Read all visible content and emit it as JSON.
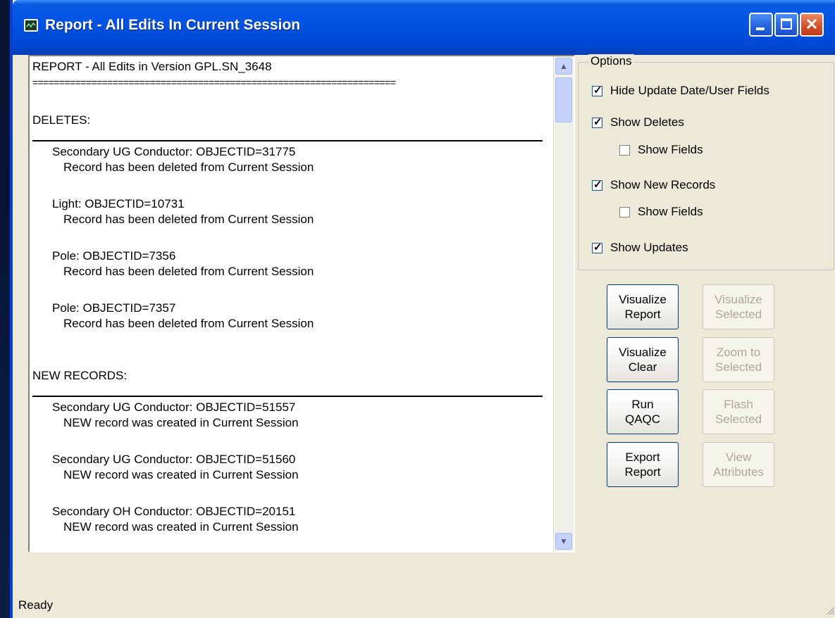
{
  "window": {
    "title": "Report - All Edits In Current Session",
    "controls": [
      "minimize",
      "maximize",
      "close"
    ]
  },
  "report": {
    "header": "REPORT - All Edits in Version GPL.SN_3648",
    "rule": "====================================================================",
    "sections": [
      {
        "heading": "DELETES:",
        "entries": [
          {
            "title": "Secondary UG Conductor: OBJECTID=31775",
            "detail": "Record has been deleted from Current Session"
          },
          {
            "title": "Light: OBJECTID=10731",
            "detail": "Record has been deleted from Current Session"
          },
          {
            "title": "Pole: OBJECTID=7356",
            "detail": "Record has been deleted from Current Session"
          },
          {
            "title": "Pole: OBJECTID=7357",
            "detail": "Record has been deleted from Current Session"
          }
        ]
      },
      {
        "heading": "NEW RECORDS:",
        "entries": [
          {
            "title": "Secondary UG Conductor: OBJECTID=51557",
            "detail": "NEW record was created in Current Session"
          },
          {
            "title": "Secondary UG Conductor: OBJECTID=51560",
            "detail": "NEW record was created in Current Session"
          },
          {
            "title": "Secondary OH Conductor: OBJECTID=20151",
            "detail": "NEW record was created in Current Session"
          }
        ]
      }
    ]
  },
  "options": {
    "legend": "Options",
    "checkboxes": [
      {
        "label": "Hide Update Date/User Fields",
        "checked": true
      },
      {
        "label": "Show Deletes",
        "checked": true
      },
      {
        "label": "Show Fields",
        "checked": false
      },
      {
        "label": "Show New Records",
        "checked": true
      },
      {
        "label": "Show Fields",
        "checked": false
      },
      {
        "label": "Show Updates",
        "checked": true
      }
    ]
  },
  "buttons": {
    "visualize_report": [
      "Visualize",
      "Report"
    ],
    "visualize_selected": [
      "Visualize",
      "Selected"
    ],
    "visualize_clear": [
      "Visualize",
      "Clear"
    ],
    "zoom_to_selected": [
      "Zoom to",
      "Selected"
    ],
    "run_qaqc": [
      "Run",
      "QAQC"
    ],
    "flash_selected": [
      "Flash",
      "Selected"
    ],
    "export_report": [
      "Export",
      "Report"
    ],
    "view_attributes": [
      "View",
      "Attributes"
    ]
  },
  "status": {
    "text": "Ready"
  },
  "colors": {
    "titlebar": "#0054e3",
    "window_bg": "#ece9d8",
    "close_button": "#d5542f"
  }
}
